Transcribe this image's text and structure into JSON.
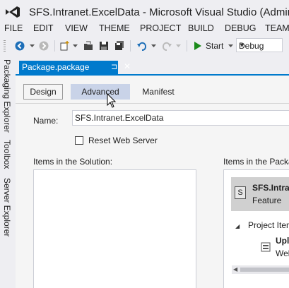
{
  "window": {
    "title": "SFS.Intranet.ExcelData - Microsoft Visual Studio (Admini"
  },
  "menu": [
    "FILE",
    "EDIT",
    "VIEW",
    "THEME",
    "PROJECT",
    "BUILD",
    "DEBUG",
    "TEAM"
  ],
  "toolbar": {
    "start_label": "Start",
    "configuration": "Debug"
  },
  "left_rail": [
    "Packaging Explorer",
    "Toolbox",
    "Server Explorer"
  ],
  "document_tab": {
    "title": "Package.package",
    "pin": "⊐",
    "close": "✕"
  },
  "designer": {
    "tabs": [
      "Design",
      "Advanced",
      "Manifest"
    ],
    "active_tab": "Advanced",
    "name_label": "Name:",
    "name_value": "SFS.Intranet.ExcelData",
    "reset_label": "Reset Web Server",
    "reset_checked": false,
    "solution_label": "Items in the Solution:",
    "package_label": "Items in the Packa",
    "package_items": {
      "feature_title": "SFS.Intrane",
      "feature_sub": "Feature",
      "group_label": "Project Item",
      "item_title": "Uplo",
      "item_sub": "Web"
    }
  },
  "colors": {
    "accent": "#007acc",
    "tab_highlight": "#c9d3e8",
    "feature_bg": "#d0d0d0"
  }
}
